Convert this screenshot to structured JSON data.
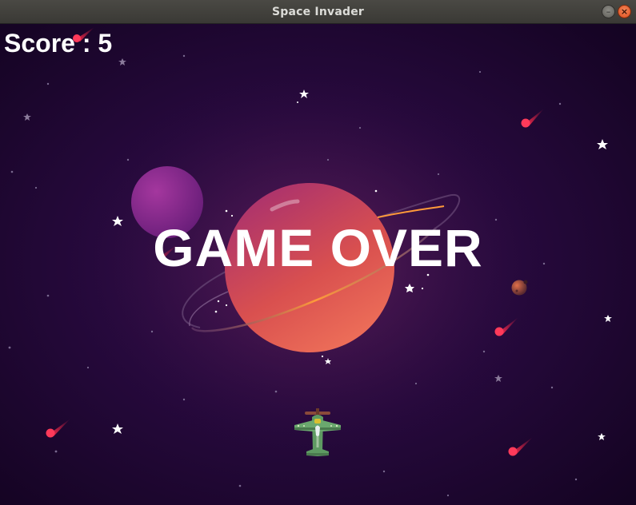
{
  "window": {
    "title": "Space Invader",
    "minimize_icon": "minimize-icon",
    "close_icon": "close-icon"
  },
  "hud": {
    "score_text": "Score : 5",
    "score_value": 5
  },
  "overlay": {
    "message": "GAME OVER"
  },
  "game": {
    "player": "green-propeller-plane",
    "enemies": "meteors",
    "meteor_count": 6,
    "background": "purple-space-with-ringed-planet"
  },
  "colors": {
    "space_dark": "#16052a",
    "space_mid": "#3a1250",
    "planet_main": "#e0594e",
    "planet_small": "#8a2a8e",
    "meteor": "#ff3a5a",
    "plane": "#5e9a62",
    "text": "#ffffff",
    "titlebar": "#3f3e3a"
  }
}
